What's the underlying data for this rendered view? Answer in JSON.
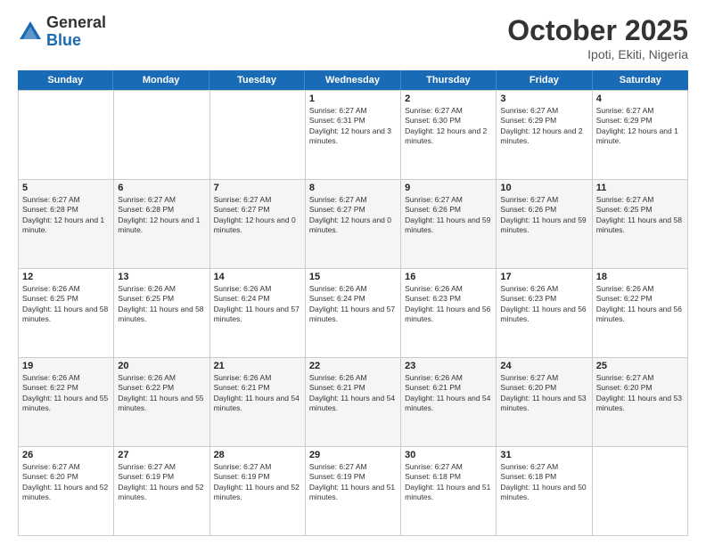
{
  "header": {
    "logo_general": "General",
    "logo_blue": "Blue",
    "month_title": "October 2025",
    "location": "Ipoti, Ekiti, Nigeria"
  },
  "weekdays": [
    "Sunday",
    "Monday",
    "Tuesday",
    "Wednesday",
    "Thursday",
    "Friday",
    "Saturday"
  ],
  "rows": [
    [
      {
        "day": "",
        "info": "",
        "alt": false
      },
      {
        "day": "",
        "info": "",
        "alt": false
      },
      {
        "day": "",
        "info": "",
        "alt": false
      },
      {
        "day": "1",
        "info": "Sunrise: 6:27 AM\nSunset: 6:31 PM\nDaylight: 12 hours and 3 minutes.",
        "alt": false
      },
      {
        "day": "2",
        "info": "Sunrise: 6:27 AM\nSunset: 6:30 PM\nDaylight: 12 hours and 2 minutes.",
        "alt": false
      },
      {
        "day": "3",
        "info": "Sunrise: 6:27 AM\nSunset: 6:29 PM\nDaylight: 12 hours and 2 minutes.",
        "alt": false
      },
      {
        "day": "4",
        "info": "Sunrise: 6:27 AM\nSunset: 6:29 PM\nDaylight: 12 hours and 1 minute.",
        "alt": false
      }
    ],
    [
      {
        "day": "5",
        "info": "Sunrise: 6:27 AM\nSunset: 6:28 PM\nDaylight: 12 hours and 1 minute.",
        "alt": true
      },
      {
        "day": "6",
        "info": "Sunrise: 6:27 AM\nSunset: 6:28 PM\nDaylight: 12 hours and 1 minute.",
        "alt": true
      },
      {
        "day": "7",
        "info": "Sunrise: 6:27 AM\nSunset: 6:27 PM\nDaylight: 12 hours and 0 minutes.",
        "alt": true
      },
      {
        "day": "8",
        "info": "Sunrise: 6:27 AM\nSunset: 6:27 PM\nDaylight: 12 hours and 0 minutes.",
        "alt": true
      },
      {
        "day": "9",
        "info": "Sunrise: 6:27 AM\nSunset: 6:26 PM\nDaylight: 11 hours and 59 minutes.",
        "alt": true
      },
      {
        "day": "10",
        "info": "Sunrise: 6:27 AM\nSunset: 6:26 PM\nDaylight: 11 hours and 59 minutes.",
        "alt": true
      },
      {
        "day": "11",
        "info": "Sunrise: 6:27 AM\nSunset: 6:25 PM\nDaylight: 11 hours and 58 minutes.",
        "alt": true
      }
    ],
    [
      {
        "day": "12",
        "info": "Sunrise: 6:26 AM\nSunset: 6:25 PM\nDaylight: 11 hours and 58 minutes.",
        "alt": false
      },
      {
        "day": "13",
        "info": "Sunrise: 6:26 AM\nSunset: 6:25 PM\nDaylight: 11 hours and 58 minutes.",
        "alt": false
      },
      {
        "day": "14",
        "info": "Sunrise: 6:26 AM\nSunset: 6:24 PM\nDaylight: 11 hours and 57 minutes.",
        "alt": false
      },
      {
        "day": "15",
        "info": "Sunrise: 6:26 AM\nSunset: 6:24 PM\nDaylight: 11 hours and 57 minutes.",
        "alt": false
      },
      {
        "day": "16",
        "info": "Sunrise: 6:26 AM\nSunset: 6:23 PM\nDaylight: 11 hours and 56 minutes.",
        "alt": false
      },
      {
        "day": "17",
        "info": "Sunrise: 6:26 AM\nSunset: 6:23 PM\nDaylight: 11 hours and 56 minutes.",
        "alt": false
      },
      {
        "day": "18",
        "info": "Sunrise: 6:26 AM\nSunset: 6:22 PM\nDaylight: 11 hours and 56 minutes.",
        "alt": false
      }
    ],
    [
      {
        "day": "19",
        "info": "Sunrise: 6:26 AM\nSunset: 6:22 PM\nDaylight: 11 hours and 55 minutes.",
        "alt": true
      },
      {
        "day": "20",
        "info": "Sunrise: 6:26 AM\nSunset: 6:22 PM\nDaylight: 11 hours and 55 minutes.",
        "alt": true
      },
      {
        "day": "21",
        "info": "Sunrise: 6:26 AM\nSunset: 6:21 PM\nDaylight: 11 hours and 54 minutes.",
        "alt": true
      },
      {
        "day": "22",
        "info": "Sunrise: 6:26 AM\nSunset: 6:21 PM\nDaylight: 11 hours and 54 minutes.",
        "alt": true
      },
      {
        "day": "23",
        "info": "Sunrise: 6:26 AM\nSunset: 6:21 PM\nDaylight: 11 hours and 54 minutes.",
        "alt": true
      },
      {
        "day": "24",
        "info": "Sunrise: 6:27 AM\nSunset: 6:20 PM\nDaylight: 11 hours and 53 minutes.",
        "alt": true
      },
      {
        "day": "25",
        "info": "Sunrise: 6:27 AM\nSunset: 6:20 PM\nDaylight: 11 hours and 53 minutes.",
        "alt": true
      }
    ],
    [
      {
        "day": "26",
        "info": "Sunrise: 6:27 AM\nSunset: 6:20 PM\nDaylight: 11 hours and 52 minutes.",
        "alt": false
      },
      {
        "day": "27",
        "info": "Sunrise: 6:27 AM\nSunset: 6:19 PM\nDaylight: 11 hours and 52 minutes.",
        "alt": false
      },
      {
        "day": "28",
        "info": "Sunrise: 6:27 AM\nSunset: 6:19 PM\nDaylight: 11 hours and 52 minutes.",
        "alt": false
      },
      {
        "day": "29",
        "info": "Sunrise: 6:27 AM\nSunset: 6:19 PM\nDaylight: 11 hours and 51 minutes.",
        "alt": false
      },
      {
        "day": "30",
        "info": "Sunrise: 6:27 AM\nSunset: 6:18 PM\nDaylight: 11 hours and 51 minutes.",
        "alt": false
      },
      {
        "day": "31",
        "info": "Sunrise: 6:27 AM\nSunset: 6:18 PM\nDaylight: 11 hours and 50 minutes.",
        "alt": false
      },
      {
        "day": "",
        "info": "",
        "alt": false
      }
    ]
  ]
}
